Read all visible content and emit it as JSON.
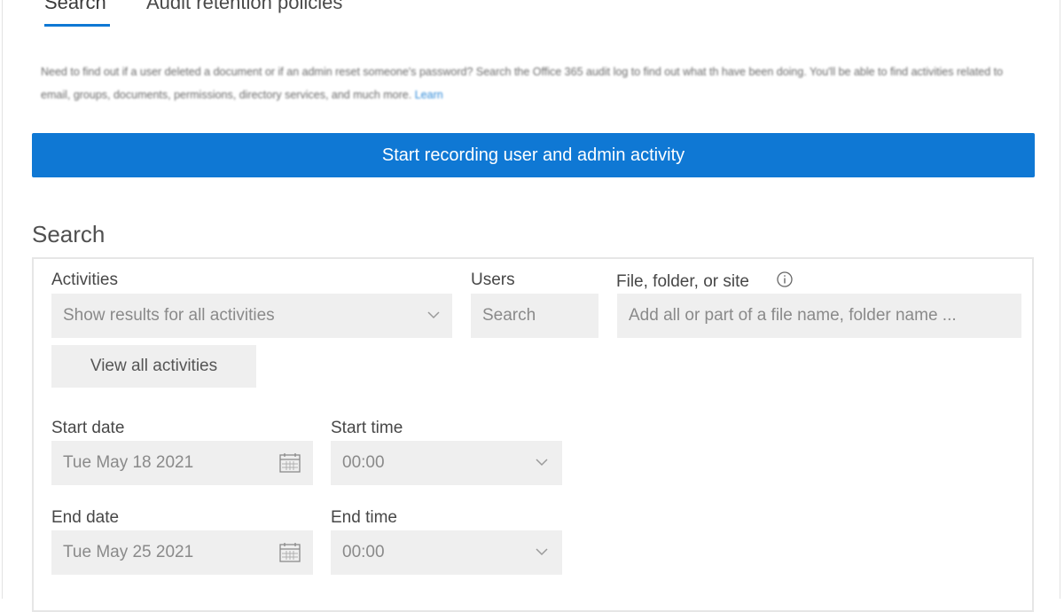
{
  "tabs": [
    {
      "label": "Search"
    },
    {
      "label": "Audit retention policies"
    }
  ],
  "intro": {
    "text": "Need to find out if a user deleted a document or if an admin reset someone's password? Search the Office 365 audit log to find out what th have been doing. You'll be able to find activities related to email, groups, documents, permissions, directory services, and much more.",
    "link": "Learn"
  },
  "cta": {
    "label": "Start recording user and admin activity"
  },
  "search": {
    "title": "Search",
    "activities": {
      "label": "Activities",
      "value": "Show results for all activities",
      "icon": "chevron-down-icon"
    },
    "view_all": {
      "label": "View all activities"
    },
    "users": {
      "label": "Users",
      "placeholder": "Search"
    },
    "file": {
      "label": "File, folder, or site",
      "placeholder": "Add all or part of a file name, folder name ...",
      "icon": "info-icon"
    },
    "start_date": {
      "label": "Start date",
      "value": "Tue May 18 2021",
      "icon": "calendar-icon"
    },
    "start_time": {
      "label": "Start time",
      "value": "00:00",
      "icon": "chevron-down-icon"
    },
    "end_date": {
      "label": "End date",
      "value": "Tue May 25 2021",
      "icon": "calendar-icon"
    },
    "end_time": {
      "label": "End time",
      "value": "00:00",
      "icon": "chevron-down-icon"
    }
  },
  "colors": {
    "accent": "#0f78d4",
    "field_bg": "#efefef"
  }
}
